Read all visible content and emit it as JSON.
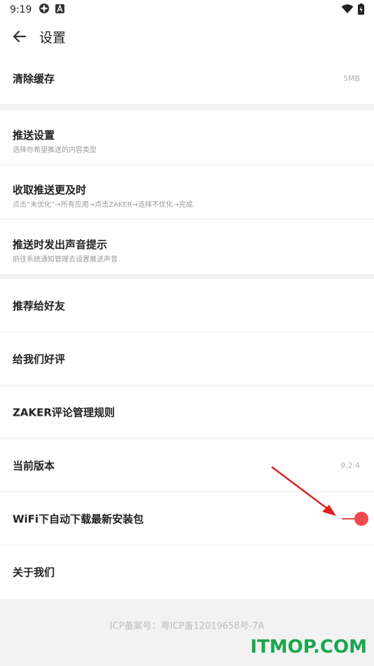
{
  "status_bar": {
    "time": "9:19"
  },
  "app_bar": {
    "title": "设置"
  },
  "cache": {
    "label": "清除缓存",
    "value": "5MB"
  },
  "push": [
    {
      "label": "推送设置",
      "sub": "选择你希望推送的内容类型"
    },
    {
      "label": "收取推送更及时",
      "sub": "点击“未优化”→所有应用→点击ZAKER→选择不优化→完成"
    },
    {
      "label": "推送时发出声音提示",
      "sub": "前往系统通知管理去设置推送声音"
    }
  ],
  "general": {
    "recommend": "推荐给好友",
    "rate": "给我们好评",
    "rules": "ZAKER评论管理规则",
    "version_label": "当前版本",
    "version_value": "9.2.4",
    "wifi_label": "WiFi下自动下载最新安装包",
    "wifi_enabled": true,
    "about": "关于我们"
  },
  "footer": {
    "icp": "ICP备案号：粤ICP备12019658号-7A"
  },
  "watermark": "ITMOP.COM",
  "colors": {
    "accent": "#f0474d",
    "watermark": "#1ba64e"
  }
}
